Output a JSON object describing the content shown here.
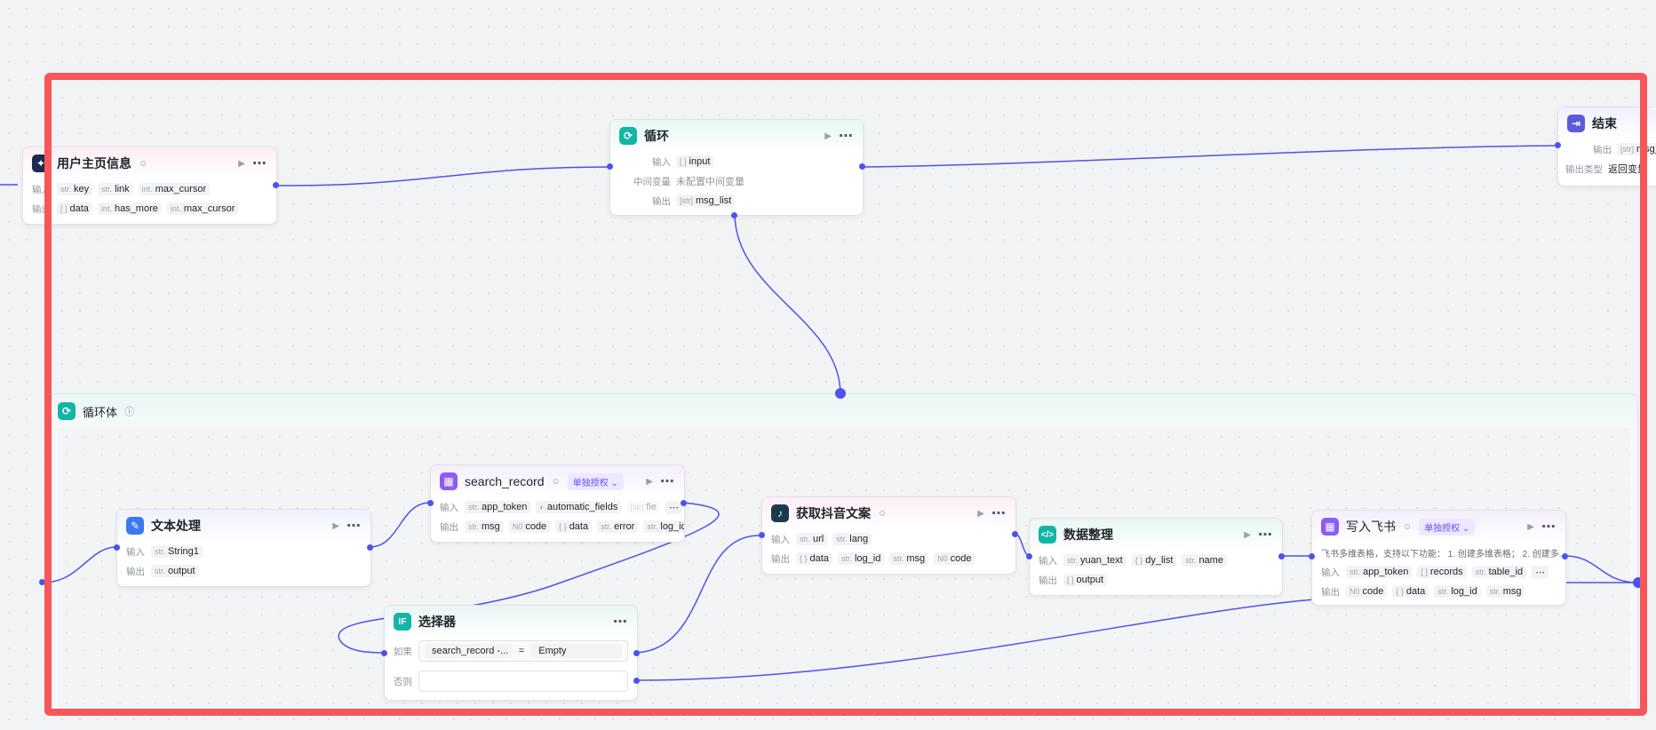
{
  "nodes": {
    "user_profile": {
      "title": "用户主页信息",
      "in_label": "输入",
      "out_label": "输出",
      "inputs": [
        {
          "type": "str.",
          "name": "key"
        },
        {
          "type": "str.",
          "name": "link"
        },
        {
          "type": "int.",
          "name": "max_cursor"
        }
      ],
      "outputs": [
        {
          "type": "[ ]",
          "name": "data"
        },
        {
          "type": "int.",
          "name": "has_more"
        },
        {
          "type": "int.",
          "name": "max_cursor"
        }
      ]
    },
    "loop": {
      "title": "循环",
      "in_label": "输入",
      "mid_label": "中间变量",
      "out_label": "输出",
      "input": {
        "type": "[ ]",
        "name": "input"
      },
      "mid_value": "未配置中间变量",
      "output": {
        "type": "[str]",
        "name": "msg_list"
      }
    },
    "end": {
      "title": "结束",
      "out_label": "输出",
      "type_label": "输出类型",
      "output": {
        "type": "[str]",
        "name": "msg_li"
      },
      "type_value": "返回变量"
    },
    "loop_body": {
      "title": "循环体"
    },
    "text_proc": {
      "title": "文本处理",
      "in_label": "输入",
      "out_label": "输出",
      "input": {
        "type": "str.",
        "name": "String1"
      },
      "output": {
        "type": "str.",
        "name": "output"
      }
    },
    "search_record": {
      "title": "search_record",
      "auth": "单独授权",
      "in_label": "输入",
      "out_label": "输出",
      "inputs": [
        {
          "type": "str.",
          "name": "app_token"
        },
        {
          "type": "◐",
          "name": "automatic_fields"
        },
        {
          "type": "[str]",
          "name": "fie"
        }
      ],
      "outputs": [
        {
          "type": "str.",
          "name": "msg"
        },
        {
          "type": "N0",
          "name": "code"
        },
        {
          "type": "{ }",
          "name": "data"
        },
        {
          "type": "str.",
          "name": "error"
        },
        {
          "type": "str.",
          "name": "log_id"
        }
      ]
    },
    "selector": {
      "title": "选择器",
      "if_label": "如果",
      "else_label": "否则",
      "cond_left": "search_record -...",
      "op": "=",
      "cond_right": "Empty"
    },
    "douyin": {
      "title": "获取抖音文案",
      "in_label": "输入",
      "out_label": "输出",
      "inputs": [
        {
          "type": "str.",
          "name": "url"
        },
        {
          "type": "str.",
          "name": "lang"
        }
      ],
      "outputs": [
        {
          "type": "{ }",
          "name": "data"
        },
        {
          "type": "str.",
          "name": "log_id"
        },
        {
          "type": "str.",
          "name": "msg"
        },
        {
          "type": "N0",
          "name": "code"
        }
      ]
    },
    "data_org": {
      "title": "数据整理",
      "in_label": "输入",
      "out_label": "输出",
      "inputs": [
        {
          "type": "str.",
          "name": "yuan_text"
        },
        {
          "type": "{ }",
          "name": "dy_list"
        },
        {
          "type": "str.",
          "name": "name"
        }
      ],
      "outputs": [
        {
          "type": "[ ]",
          "name": "output"
        }
      ]
    },
    "feishu": {
      "title": "写入飞书",
      "auth": "单独授权",
      "desc": "飞书多维表格，支持以下功能： 1. 创建多维表格； 2. 创建多...",
      "in_label": "输入",
      "out_label": "输出",
      "inputs": [
        {
          "type": "str.",
          "name": "app_token"
        },
        {
          "type": "[ ]",
          "name": "records"
        },
        {
          "type": "str.",
          "name": "table_id"
        }
      ],
      "outputs": [
        {
          "type": "N0",
          "name": "code"
        },
        {
          "type": "{ }",
          "name": "data"
        },
        {
          "type": "str.",
          "name": "log_id"
        },
        {
          "type": "str.",
          "name": "msg"
        }
      ]
    }
  },
  "colors": {
    "edge": "#4d53e8",
    "selection": "#f65659"
  },
  "icons": [
    "bot-icon",
    "loop-icon",
    "end-icon",
    "text-icon",
    "table-icon",
    "if-icon",
    "app-icon",
    "code-icon",
    "play-icon",
    "more-icon",
    "info-icon",
    "auth-dropdown-icon"
  ]
}
